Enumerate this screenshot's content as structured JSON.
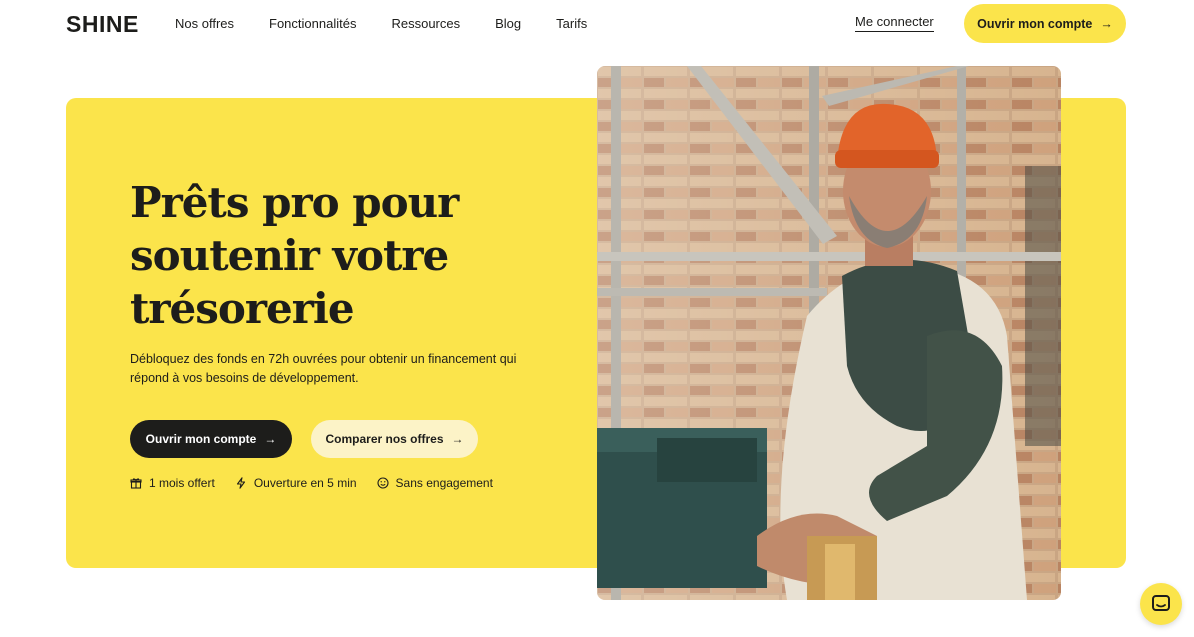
{
  "header": {
    "logo": "SHINE",
    "nav": [
      "Nos offres",
      "Fonctionnalités",
      "Ressources",
      "Blog",
      "Tarifs"
    ],
    "login": "Me connecter",
    "cta": "Ouvrir mon compte"
  },
  "hero": {
    "title": "Prêts pro pour soutenir votre trésorerie",
    "description": "Débloquez des fonds en 72h ouvrées pour obtenir un financement qui répond à vos besoins de développement.",
    "primary_button": "Ouvrir mon compte",
    "secondary_button": "Comparer nos offres",
    "perks": [
      {
        "icon": "gift-icon",
        "label": "1 mois offert"
      },
      {
        "icon": "lightning-icon",
        "label": "Ouverture en 5 min"
      },
      {
        "icon": "smile-icon",
        "label": "Sans engagement"
      }
    ]
  },
  "colors": {
    "brand_yellow": "#fbe44b",
    "dark": "#1d1d1b",
    "light_button": "#fcf3c7"
  },
  "icons": {
    "arrow": "arrow-right-icon",
    "chat": "chat-icon"
  }
}
